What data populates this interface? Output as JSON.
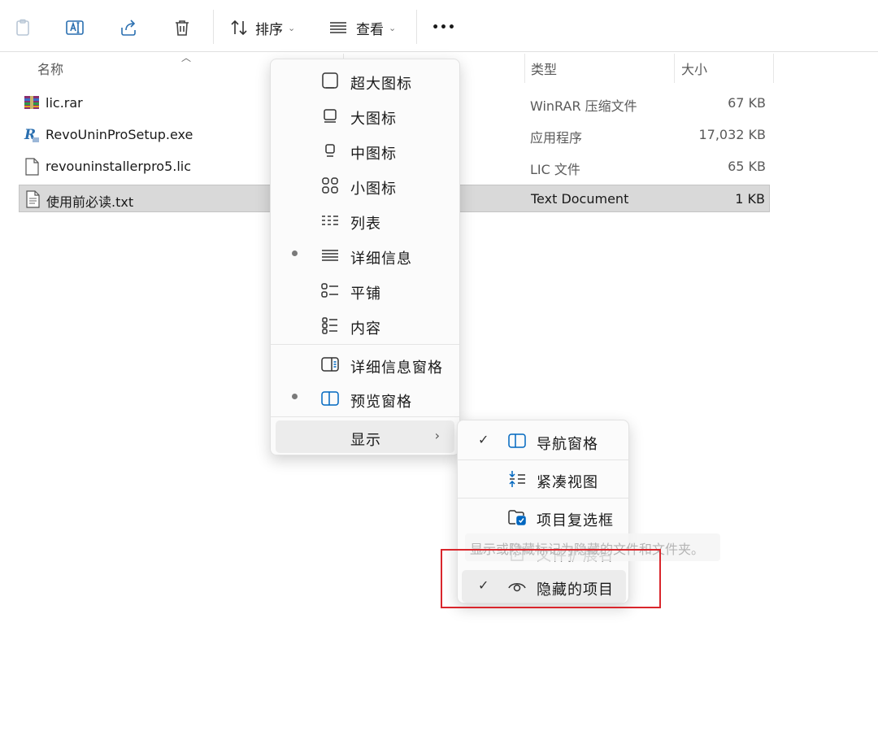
{
  "toolbar": {
    "buttons": [
      {
        "name": "paste-icon"
      },
      {
        "name": "rename-icon"
      },
      {
        "name": "share-icon"
      },
      {
        "name": "delete-icon"
      }
    ],
    "sort_label": "排序",
    "view_label": "查看",
    "more_label": "•••"
  },
  "columns": {
    "name": "名称",
    "type": "类型",
    "size": "大小"
  },
  "files": [
    {
      "name": "lic.rar",
      "type": "WinRAR 压缩文件",
      "size": "67 KB",
      "icon": "rar-archive-icon"
    },
    {
      "name": "RevoUninProSetup.exe",
      "type": "应用程序",
      "size": "17,032 KB",
      "icon": "exe-app-icon"
    },
    {
      "name": "revouninstallerpro5.lic",
      "type": "LIC 文件",
      "size": "65 KB",
      "icon": "file-icon"
    },
    {
      "name": "使用前必读.txt",
      "type": "Text Document",
      "size": "1 KB",
      "icon": "text-file-icon",
      "selected": true
    }
  ],
  "view_menu": {
    "items": [
      {
        "label": "超大图标",
        "icon": "extra-large-icons-icon",
        "checked": false
      },
      {
        "label": "大图标",
        "icon": "large-icons-icon",
        "checked": false
      },
      {
        "label": "中图标",
        "icon": "medium-icons-icon",
        "checked": false
      },
      {
        "label": "小图标",
        "icon": "small-icons-icon",
        "checked": false
      },
      {
        "label": "列表",
        "icon": "list-icon",
        "checked": false
      },
      {
        "label": "详细信息",
        "icon": "details-icon",
        "checked": true
      },
      {
        "label": "平铺",
        "icon": "tiles-icon",
        "checked": false
      },
      {
        "label": "内容",
        "icon": "content-icon",
        "checked": false
      },
      {
        "label": "详细信息窗格",
        "icon": "details-pane-icon",
        "checked": false
      },
      {
        "label": "预览窗格",
        "icon": "preview-pane-icon",
        "checked": true
      },
      {
        "label": "显示",
        "icon": "",
        "submenu_arrow": "›"
      }
    ]
  },
  "show_submenu": {
    "items": [
      {
        "label": "导航窗格",
        "icon": "navigation-pane-icon",
        "checked": true
      },
      {
        "label": "紧凑视图",
        "icon": "compact-view-icon",
        "checked": false
      },
      {
        "label": "项目复选框",
        "icon": "item-checkbox-icon",
        "checked": false
      },
      {
        "label": "文件扩展名",
        "icon": "file-extension-icon",
        "checked": true
      },
      {
        "label": "隐藏的项目",
        "icon": "eye-icon",
        "checked": true
      }
    ],
    "check_glyph": "✓"
  },
  "tooltip": "显示或隐藏标记为隐藏的文件和文件夹。",
  "colors": {
    "accent": "#0067c0",
    "highlight_box": "#d9262c",
    "selected_row": "#d9d9d9"
  }
}
